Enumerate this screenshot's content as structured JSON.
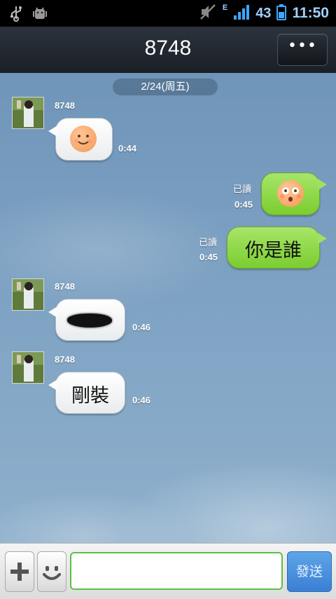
{
  "status_bar": {
    "network_type": "E",
    "battery_level": "43",
    "time": "11:50",
    "icons": [
      "usb-icon",
      "android-debug-icon",
      "mute-icon",
      "signal-icon",
      "battery-icon"
    ]
  },
  "header": {
    "title": "8748",
    "menu_label": "•••"
  },
  "chat": {
    "date_divider": "2/24(周五)",
    "messages": [
      {
        "direction": "incoming",
        "sender": "8748",
        "type": "sticker",
        "sticker": "smile-face",
        "time": "0:44"
      },
      {
        "direction": "outgoing",
        "read_label": "已讀",
        "type": "sticker",
        "sticker": "surprised-face",
        "time": "0:45"
      },
      {
        "direction": "outgoing",
        "read_label": "已讀",
        "type": "text",
        "text": "你是誰",
        "time": "0:45"
      },
      {
        "direction": "incoming",
        "sender": "8748",
        "type": "redacted",
        "time": "0:46"
      },
      {
        "direction": "incoming",
        "sender": "8748",
        "type": "text",
        "text": "剛裝",
        "time": "0:46"
      }
    ]
  },
  "input_bar": {
    "add_icon": "plus-icon",
    "emoji_icon": "smiley-icon",
    "message_value": "",
    "send_label": "發送"
  },
  "colors": {
    "incoming_bubble": "#ffffff",
    "outgoing_bubble": "#8ed84a",
    "send_button": "#4a8fde",
    "input_border": "#5ac046"
  }
}
